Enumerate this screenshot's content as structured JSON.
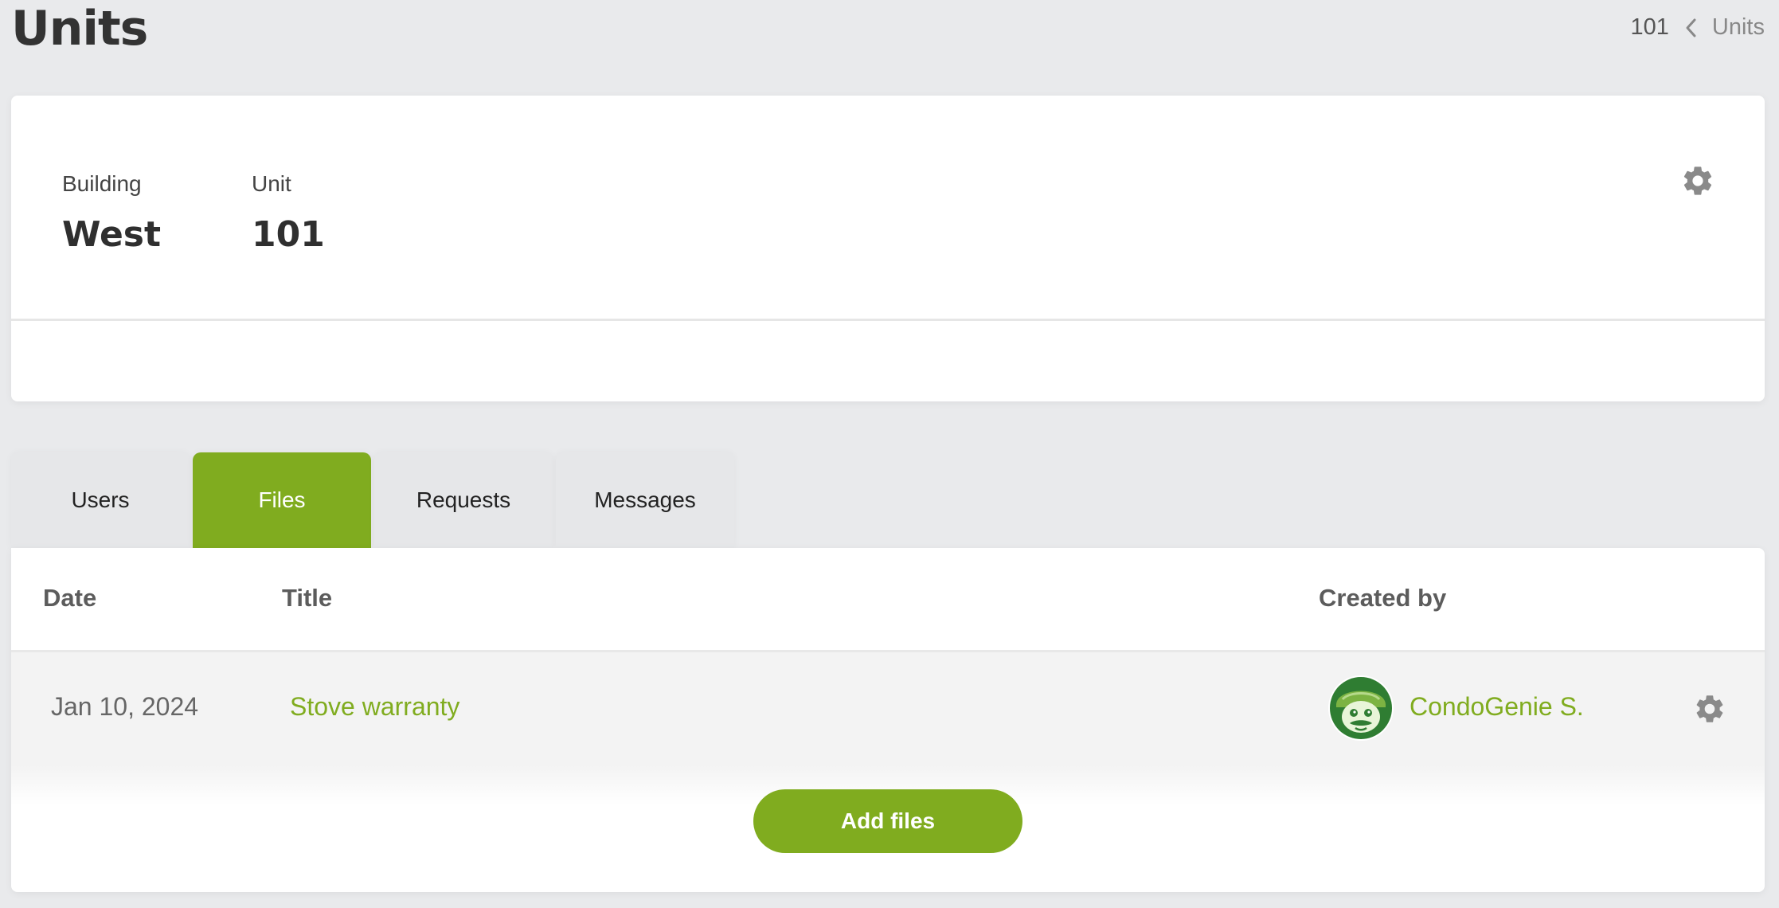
{
  "page": {
    "title": "Units"
  },
  "breadcrumb": {
    "current": "101",
    "parent": "Units"
  },
  "unit_info": {
    "building_label": "Building",
    "building_value": "West",
    "unit_label": "Unit",
    "unit_value": "101"
  },
  "tabs": [
    {
      "label": "Users",
      "active": false
    },
    {
      "label": "Files",
      "active": true
    },
    {
      "label": "Requests",
      "active": false
    },
    {
      "label": "Messages",
      "active": false
    }
  ],
  "files_table": {
    "columns": [
      "Date",
      "Title",
      "Created by"
    ],
    "rows": [
      {
        "date": "Jan 10, 2024",
        "title": "Stove warranty",
        "created_by": "CondoGenie S.",
        "avatar_icon": "condogenie-avatar-icon"
      }
    ]
  },
  "actions": {
    "add_files_label": "Add files"
  },
  "colors": {
    "accent": "#80ac1f",
    "background": "#e9eaec",
    "card": "#ffffff",
    "row": "#f3f3f3"
  },
  "icons": {
    "settings": "gear-icon",
    "breadcrumb_separator": "chevron-left-icon"
  }
}
